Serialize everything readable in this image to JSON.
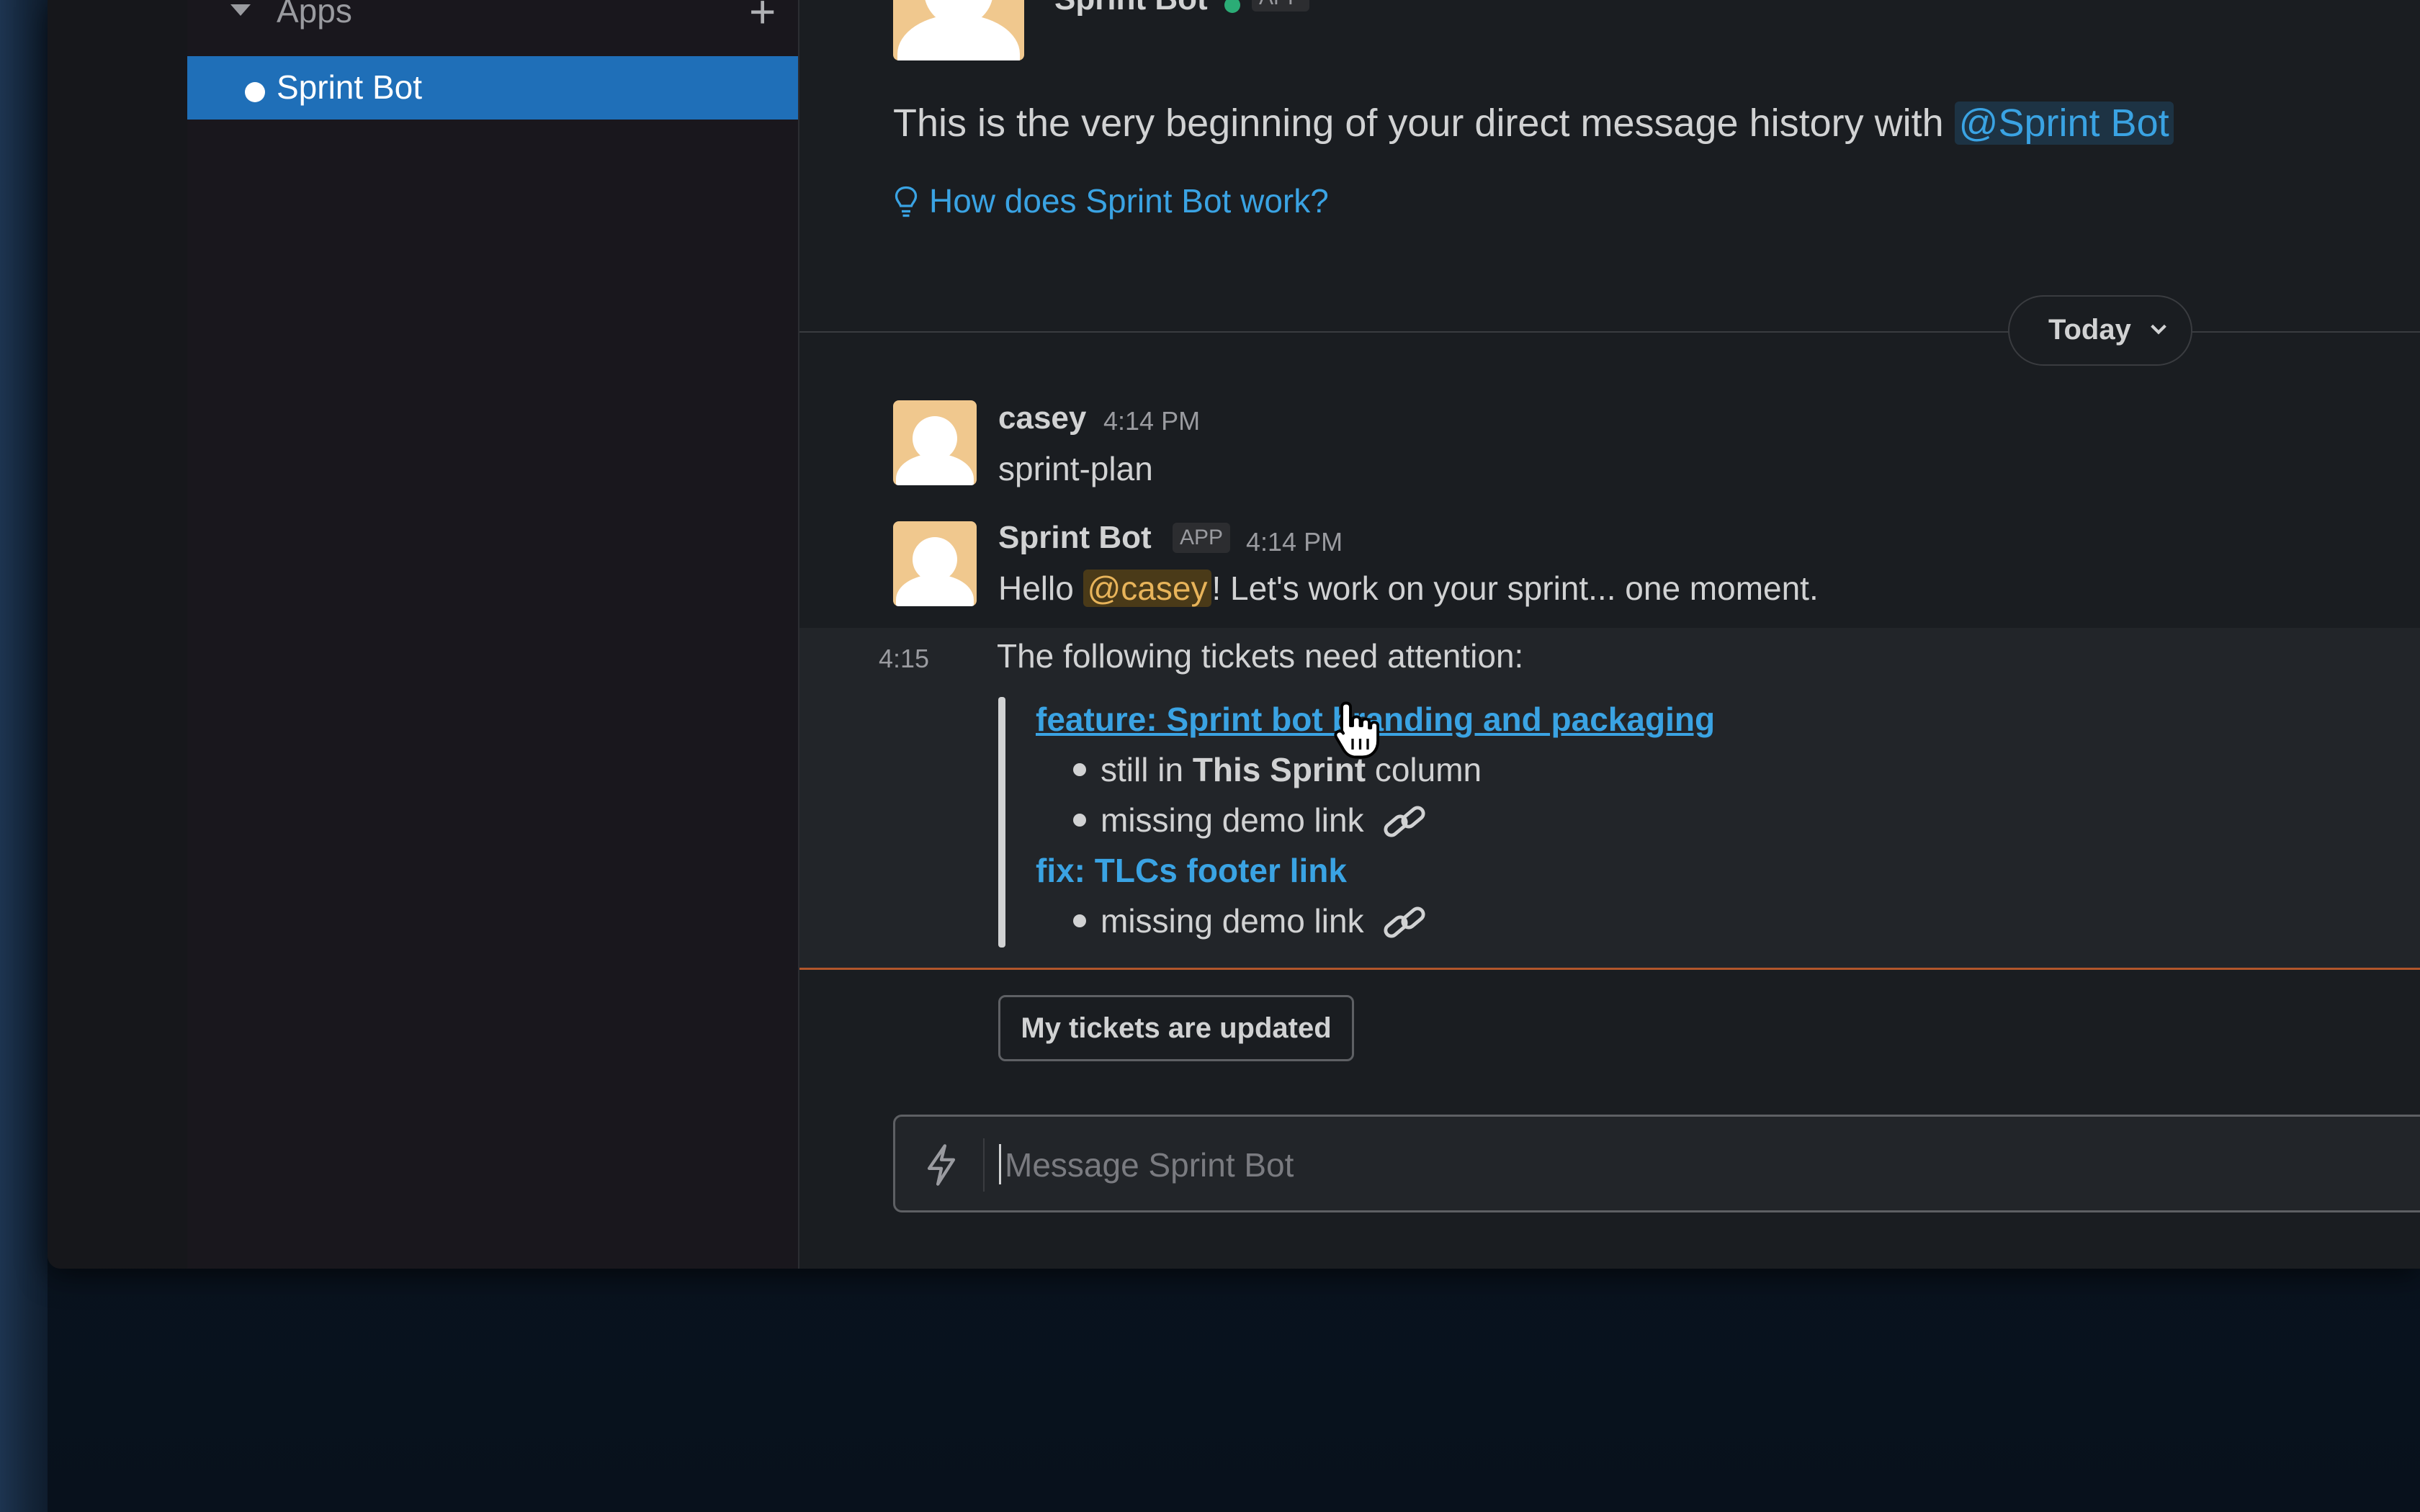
{
  "sidebar": {
    "section_label": "Apps",
    "add_symbol": "+",
    "active_channel": "Sprint Bot"
  },
  "header": {
    "bot_name": "Sprint Bot",
    "app_badge": "APP"
  },
  "intro": {
    "text": "This is the very beginning of your direct message history with ",
    "mention": "@Sprint Bot",
    "help_link": "How does Sprint Bot work?"
  },
  "divider": {
    "label": "Today"
  },
  "messages": [
    {
      "author": "casey",
      "time": "4:14 PM",
      "text": "sprint-plan"
    },
    {
      "author": "Sprint Bot",
      "badge": "APP",
      "time": "4:14 PM",
      "text_before": "Hello ",
      "mention": "@casey",
      "text_after": "! Let's work on your sprint... one moment."
    }
  ],
  "followup": {
    "time": "4:15",
    "text": "The following tickets need attention:",
    "tickets": [
      {
        "title": "feature: Sprint bot branding and packaging",
        "notes": [
          {
            "before": "still in ",
            "bold": "This Sprint",
            "after": " column"
          },
          {
            "before": "missing demo link",
            "bold": "",
            "after": ""
          }
        ]
      },
      {
        "title": "fix: TLCs footer link",
        "notes": [
          {
            "before": "missing demo link",
            "bold": "",
            "after": ""
          }
        ]
      }
    ]
  },
  "action_button": "My tickets are updated",
  "composer": {
    "placeholder": "Message Sprint Bot"
  },
  "colors": {
    "accent_blue": "#1f6fb8",
    "link": "#3aa3e3",
    "online": "#2bac76",
    "new_divider": "#b2562b",
    "avatar_bg": "#f0c88e",
    "mention_user": "#e8b45a"
  }
}
